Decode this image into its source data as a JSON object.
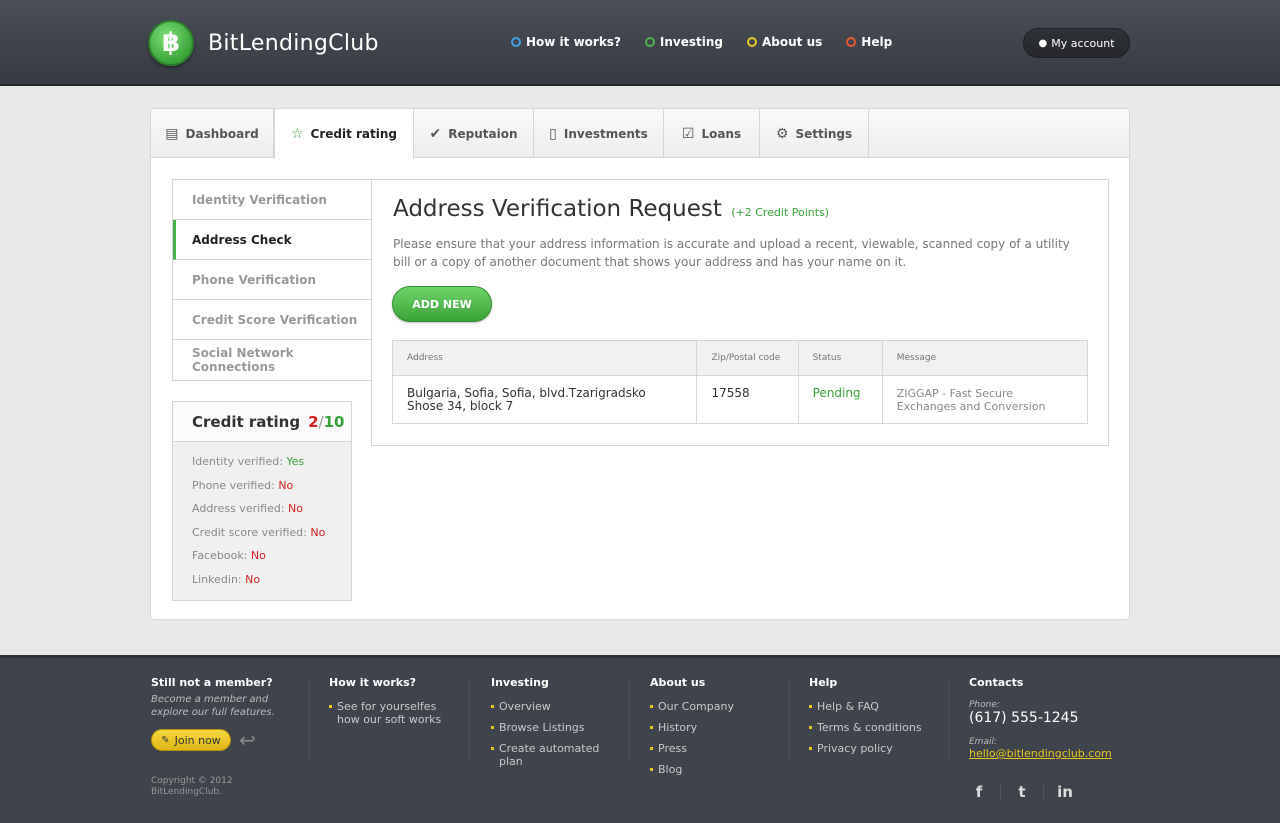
{
  "header": {
    "logo_glyph": "฿",
    "logo_text": "BitLendingClub",
    "nav": [
      {
        "label": "How it works?",
        "color": "#3ba2e8"
      },
      {
        "label": "Investing",
        "color": "#46b446"
      },
      {
        "label": "About us",
        "color": "#e8c61c"
      },
      {
        "label": "Help",
        "color": "#e8582c"
      }
    ],
    "account_label": "My account"
  },
  "tabs": [
    {
      "label": "Dashboard",
      "icon": "dashboard-icon",
      "glyph": "▤"
    },
    {
      "label": "Credit rating",
      "icon": "star-icon",
      "glyph": "☆"
    },
    {
      "label": "Reputaion",
      "icon": "check-icon",
      "glyph": "✔"
    },
    {
      "label": "Investments",
      "icon": "document-icon",
      "glyph": "▯"
    },
    {
      "label": "Loans",
      "icon": "checklist-icon",
      "glyph": "☑"
    },
    {
      "label": "Settings",
      "icon": "gear-icon",
      "glyph": "⚙"
    }
  ],
  "side_menu": [
    "Identity Verification",
    "Address Check",
    "Phone Verification",
    "Credit Score Verification",
    "Social Network Connections"
  ],
  "rating": {
    "title": "Credit rating",
    "score": "2",
    "separator": "/",
    "max": "10",
    "rows": [
      {
        "label": "Identity verified:",
        "value": "Yes"
      },
      {
        "label": "Phone verified:",
        "value": "No"
      },
      {
        "label": "Address verified:",
        "value": "No"
      },
      {
        "label": "Credit score verified:",
        "value": "No"
      },
      {
        "label": "Facebook:",
        "value": "No"
      },
      {
        "label": "Linkedin:",
        "value": "No"
      }
    ]
  },
  "content": {
    "title": "Address Verification Request",
    "points": "(+2 Credit Points)",
    "description": "Please ensure that your address information is accurate and upload a recent, viewable, scanned copy of a utility bill or a copy of another document that shows your address and has your name on it.",
    "add_button": "ADD NEW",
    "table": {
      "headers": [
        "Address",
        "Zip/Postal code",
        "Status",
        "Message"
      ],
      "rows": [
        [
          "Bulgaria, Sofia, Sofia, blvd.Tzarigradsko Shose 34, block 7",
          "17558",
          "Pending",
          "ZIGGAP - Fast Secure Exchanges and Conversion"
        ]
      ]
    }
  },
  "footer": {
    "member": {
      "title": "Still not a member?",
      "subtitle": "Become a member and explore our full features.",
      "join_label": "Join now"
    },
    "how": {
      "title": "How it works?",
      "items": [
        "See for yourselfes how our soft works"
      ]
    },
    "investing": {
      "title": "Investing",
      "items": [
        "Overview",
        "Browse Listings",
        "Create automated plan"
      ]
    },
    "about": {
      "title": "About us",
      "items": [
        "Our Company",
        "History",
        "Press",
        "Blog"
      ]
    },
    "help": {
      "title": "Help",
      "items": [
        "Help & FAQ",
        "Terms & conditions",
        "Privacy policy"
      ]
    },
    "contacts": {
      "title": "Contacts",
      "phone_label": "Phone:",
      "phone": "(617) 555-1245",
      "email_label": "Email:",
      "email": "hello@bitlendingclub.com"
    },
    "copyright": "Copyright © 2012 BitLendingClub.",
    "social": [
      {
        "name": "facebook-icon",
        "glyph": "f"
      },
      {
        "name": "twitter-icon",
        "glyph": "t"
      },
      {
        "name": "linkedin-icon",
        "glyph": "in"
      }
    ]
  }
}
